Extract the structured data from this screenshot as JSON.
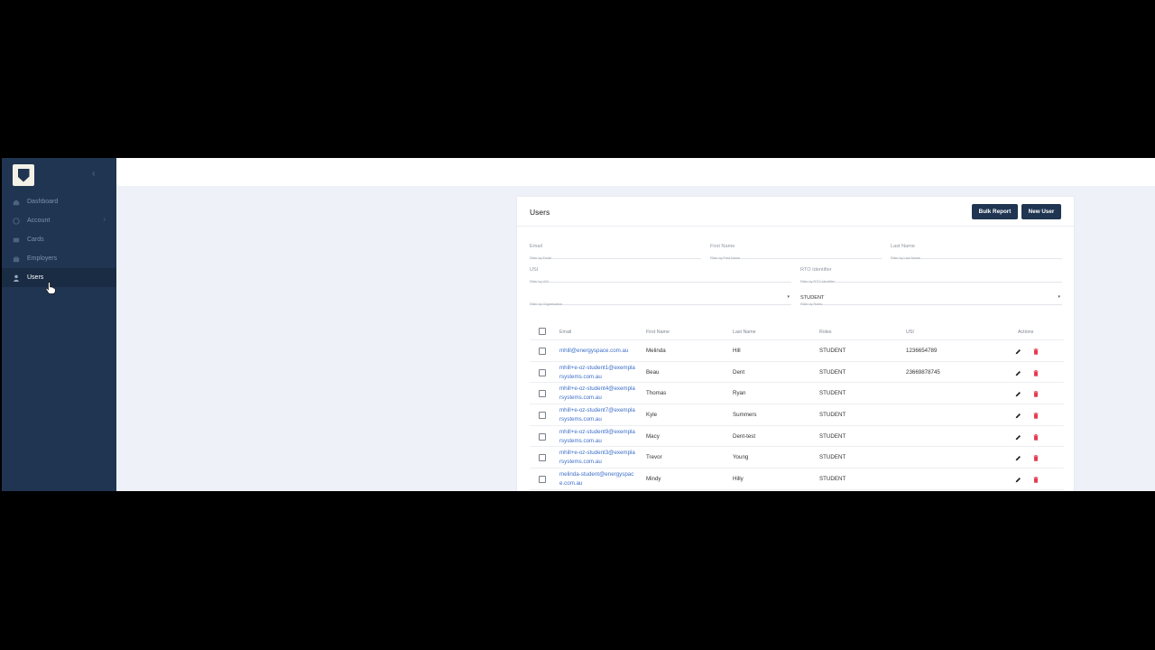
{
  "sidebar": {
    "items": [
      {
        "label": "Dashboard",
        "icon": "home-icon",
        "active": false
      },
      {
        "label": "Account",
        "icon": "account-icon",
        "active": false,
        "has_submenu": true
      },
      {
        "label": "Cards",
        "icon": "card-icon",
        "active": false
      },
      {
        "label": "Employers",
        "icon": "briefcase-icon",
        "active": false
      },
      {
        "label": "Users",
        "icon": "user-icon",
        "active": true
      }
    ],
    "collapse_icon": "chevron-left-icon"
  },
  "users_card": {
    "title": "Users",
    "bulk_report_label": "Bulk Report",
    "new_user_label": "New User",
    "filters": {
      "email": {
        "label": "Email",
        "help": "Filter by Email"
      },
      "first_name": {
        "label": "First Name",
        "help": "Filter by First Name"
      },
      "last_name": {
        "label": "Last Name",
        "help": "Filter by Last Name"
      },
      "usi": {
        "label": "USI",
        "help": "Filter by USI"
      },
      "rto": {
        "label": "RTO Identifier",
        "help": "Filter by RTO Identifier"
      },
      "organisation": {
        "label": "",
        "help": "Filter by Organisation"
      },
      "roles": {
        "value": "STUDENT",
        "help": "Filter by Roles"
      }
    },
    "columns": [
      "Email",
      "First Name",
      "Last Name",
      "Roles",
      "USI",
      "Actions"
    ],
    "rows": [
      {
        "email1": "mhill@energyspace.com.au",
        "email2": "",
        "first": "Melinda",
        "last": "Hill",
        "role": "STUDENT",
        "usi": "1236654789"
      },
      {
        "email1": "mhill+e-oz-student1@exempla",
        "email2": "rsystems.com.au",
        "first": "Beau",
        "last": "Dent",
        "role": "STUDENT",
        "usi": "23669878745"
      },
      {
        "email1": "mhill+e-oz-student4@exempla",
        "email2": "rsystems.com.au",
        "first": "Thomas",
        "last": "Ryan",
        "role": "STUDENT",
        "usi": ""
      },
      {
        "email1": "mhill+e-oz-student7@exempla",
        "email2": "rsystems.com.au",
        "first": "Kyle",
        "last": "Summers",
        "role": "STUDENT",
        "usi": ""
      },
      {
        "email1": "mhill+e-oz-student9@exempla",
        "email2": "rsystems.com.au",
        "first": "Macy",
        "last": "Dent-test",
        "role": "STUDENT",
        "usi": ""
      },
      {
        "email1": "mhill+e-oz-student3@exempla",
        "email2": "rsystems.com.au",
        "first": "Trevor",
        "last": "Young",
        "role": "STUDENT",
        "usi": ""
      },
      {
        "email1": "melinda-student@energyspac",
        "email2": "e.com.au",
        "first": "Mindy",
        "last": "Hilly",
        "role": "STUDENT",
        "usi": ""
      }
    ]
  },
  "colors": {
    "sidebar_bg": "#1f3552",
    "accent": "#1f3552",
    "link": "#3d6fc9",
    "delete": "#e53950"
  }
}
